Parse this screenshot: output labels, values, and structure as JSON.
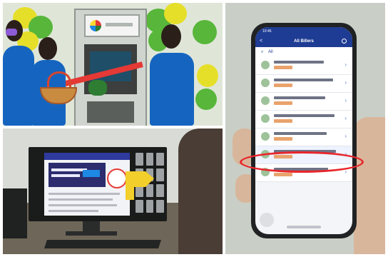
{
  "photo_panels": {
    "atm_scene": {
      "subject": "atm-ribbon-cutting"
    },
    "desktop_scene": {
      "subject": "computer-monitor-website"
    },
    "phone_scene": {
      "subject": "smartphone-billers-app"
    }
  },
  "phone_app": {
    "status_time": "10:46",
    "title": "All Billers",
    "back_symbol": "<",
    "filter_label": "All",
    "chevron_symbol": "›",
    "billers": [
      {
        "row_id": "biller-1"
      },
      {
        "row_id": "biller-2"
      },
      {
        "row_id": "biller-3"
      },
      {
        "row_id": "biller-4"
      },
      {
        "row_id": "biller-5"
      },
      {
        "row_id": "biller-6"
      },
      {
        "row_id": "biller-7"
      }
    ],
    "highlighted_index": 5
  },
  "colors": {
    "app_blue": "#1f3c94",
    "highlight_red": "#e8262c",
    "shirt_blue": "#1565c0",
    "balloon_green": "#58b63a",
    "balloon_yellow": "#e6df2a"
  }
}
